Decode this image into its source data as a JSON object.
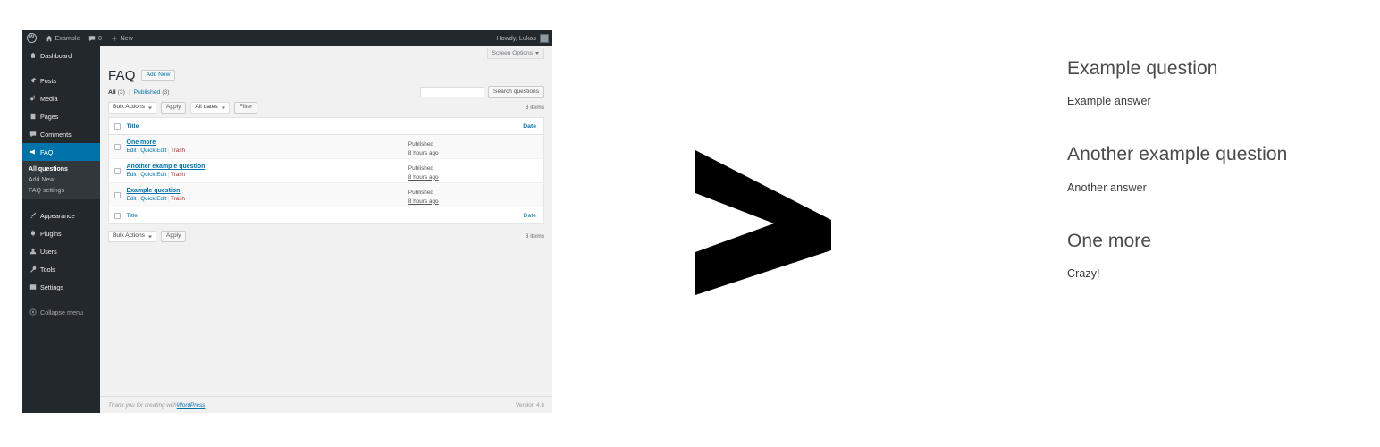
{
  "adminbar": {
    "logo": "wordpress-logo",
    "site_name": "Example",
    "comment_count": "0",
    "new_label": "New",
    "howdy": "Howdy, Lukas"
  },
  "sidebar": {
    "items": [
      {
        "label": "Dashboard",
        "icon": "dashboard-icon",
        "current": false
      },
      {
        "label": "Posts",
        "icon": "pin-icon",
        "current": false
      },
      {
        "label": "Media",
        "icon": "media-icon",
        "current": false
      },
      {
        "label": "Pages",
        "icon": "page-icon",
        "current": false
      },
      {
        "label": "Comments",
        "icon": "comment-icon",
        "current": false
      },
      {
        "label": "FAQ",
        "icon": "megaphone-icon",
        "current": true
      },
      {
        "label": "Appearance",
        "icon": "brush-icon",
        "current": false
      },
      {
        "label": "Plugins",
        "icon": "plug-icon",
        "current": false
      },
      {
        "label": "Users",
        "icon": "users-icon",
        "current": false
      },
      {
        "label": "Tools",
        "icon": "tools-icon",
        "current": false
      },
      {
        "label": "Settings",
        "icon": "settings-icon",
        "current": false
      },
      {
        "label": "Collapse menu",
        "icon": "collapse-icon",
        "current": false
      }
    ],
    "submenu": [
      {
        "label": "All questions",
        "active": true
      },
      {
        "label": "Add New",
        "active": false
      },
      {
        "label": "FAQ settings",
        "active": false
      }
    ]
  },
  "screen_options": {
    "label": "Screen Options",
    "icon": "chevron-down-icon"
  },
  "page": {
    "title": "FAQ",
    "add_new": "Add New",
    "views": {
      "all_label": "All",
      "all_count": "(3)",
      "separator": "|",
      "published_label": "Published",
      "published_count": "(3)"
    },
    "search": {
      "value": "",
      "placeholder": "",
      "button": "Search questions"
    },
    "tablenav_top": {
      "bulk_actions": "Bulk Actions",
      "apply": "Apply",
      "dates": "All dates",
      "filter": "Filter",
      "count": "3 items"
    },
    "tablenav_bottom": {
      "bulk_actions": "Bulk Actions",
      "apply": "Apply",
      "count": "3 items"
    },
    "table": {
      "columns": {
        "title": "Title",
        "date": "Date"
      },
      "rows": [
        {
          "title": "One more",
          "actions": {
            "edit": "Edit",
            "quick_edit": "Quick Edit",
            "trash": "Trash"
          },
          "status": "Published",
          "relative": "8 hours ago"
        },
        {
          "title": "Another example question",
          "actions": {
            "edit": "Edit",
            "quick_edit": "Quick Edit",
            "trash": "Trash"
          },
          "status": "Published",
          "relative": "8 hours ago"
        },
        {
          "title": "Example question",
          "actions": {
            "edit": "Edit",
            "quick_edit": "Quick Edit",
            "trash": "Trash"
          },
          "status": "Published",
          "relative": "8 hours ago"
        }
      ]
    },
    "footer": {
      "thanks_prefix": "Thank you for creating with ",
      "link": "WordPress",
      "thanks_suffix": ".",
      "version": "Version 4.8"
    }
  },
  "arrow": {
    "icon": "chevron-right-icon",
    "color": "#000000"
  },
  "frontend": {
    "faqs": [
      {
        "question": "Example question",
        "answer": "Example answer"
      },
      {
        "question": "Another example question",
        "answer": "Another answer"
      },
      {
        "question": "One more",
        "answer": "Crazy!"
      }
    ]
  },
  "colors": {
    "admin_bar": "#23282d",
    "menu_current": "#0073aa",
    "submenu_bg": "#32373c",
    "link": "#0073aa",
    "trash": "#b32d2e"
  }
}
